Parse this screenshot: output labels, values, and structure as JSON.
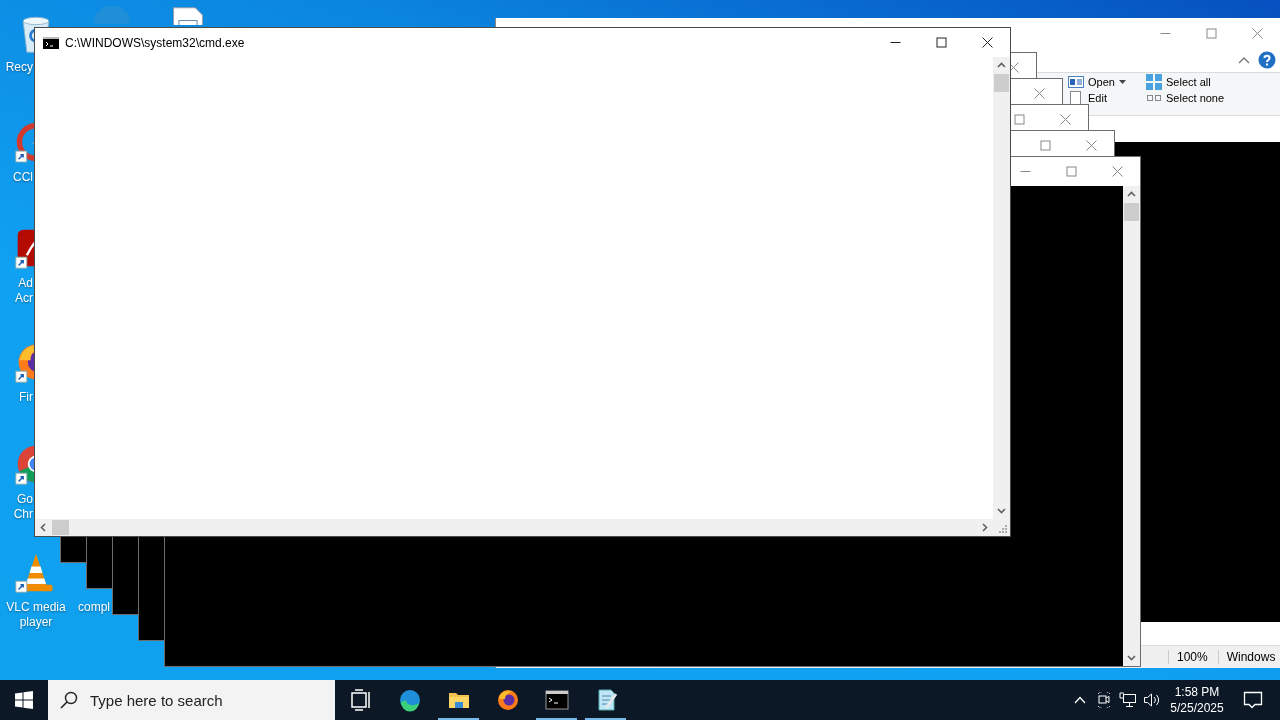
{
  "desktop_icons": [
    {
      "kind": "recycle-bin",
      "label_lines": [
        "Recy"
      ]
    },
    {
      "kind": "swirl-browser"
    },
    {
      "kind": "document"
    },
    {
      "kind": "cleaner",
      "label_lines": [
        "CCl"
      ]
    },
    {
      "kind": "pdf-reader",
      "label_lines": [
        "Ad",
        "Acr"
      ]
    },
    {
      "kind": "fox-browser",
      "label_lines": [
        "Fir"
      ]
    },
    {
      "kind": "round-browser",
      "label_lines": [
        "Go",
        "Chr"
      ]
    },
    {
      "kind": "media-player",
      "label_lines": [
        "VLC media",
        "player"
      ]
    },
    {
      "kind": "hidden",
      "label_lines": [
        "compl"
      ]
    }
  ],
  "explorer_window": {
    "ribbon": [
      {
        "label": "Open",
        "dropdown": true,
        "kind": "open"
      },
      {
        "label": "Edit",
        "dropdown": false,
        "kind": "edit"
      },
      {
        "label": "Select all",
        "dropdown": false,
        "kind": "select-all"
      },
      {
        "label": "Select none",
        "dropdown": false,
        "kind": "select-none"
      }
    ],
    "status_bar": [
      "100%",
      "Windows"
    ]
  },
  "console_windows": [
    {
      "kind": "dark",
      "controls": [
        {
          "kind": "close"
        }
      ],
      "scrollbar": false
    },
    {
      "kind": "dark",
      "controls": [
        {
          "kind": "close"
        }
      ],
      "scrollbar": false
    },
    {
      "kind": "dark",
      "controls": [
        {
          "kind": "maximize"
        },
        {
          "kind": "close"
        }
      ],
      "scrollbar": false
    },
    {
      "kind": "dark",
      "controls": [
        {
          "kind": "maximize"
        },
        {
          "kind": "close"
        }
      ],
      "scrollbar": false
    },
    {
      "kind": "dark",
      "controls": [
        {
          "kind": "minimize"
        },
        {
          "kind": "maximize"
        },
        {
          "kind": "close"
        }
      ],
      "scrollbar": true
    },
    {
      "kind": "light",
      "title": "C:\\WINDOWS\\system32\\cmd.exe",
      "controls": [
        {
          "kind": "minimize"
        },
        {
          "kind": "maximize"
        },
        {
          "kind": "close"
        }
      ],
      "scrollbar": true
    }
  ],
  "taskbar": {
    "search": {
      "placeholder": "Type here to search"
    },
    "apps": [
      {
        "kind": "task-view",
        "open": false
      },
      {
        "kind": "swirl-browser",
        "open": false
      },
      {
        "kind": "folder",
        "open": true
      },
      {
        "kind": "fox-browser",
        "open": false
      },
      {
        "kind": "terminal",
        "open": true
      },
      {
        "kind": "notepad",
        "open": true
      }
    ],
    "tray": {
      "time": "1:58 PM",
      "date": "5/25/2025"
    }
  }
}
